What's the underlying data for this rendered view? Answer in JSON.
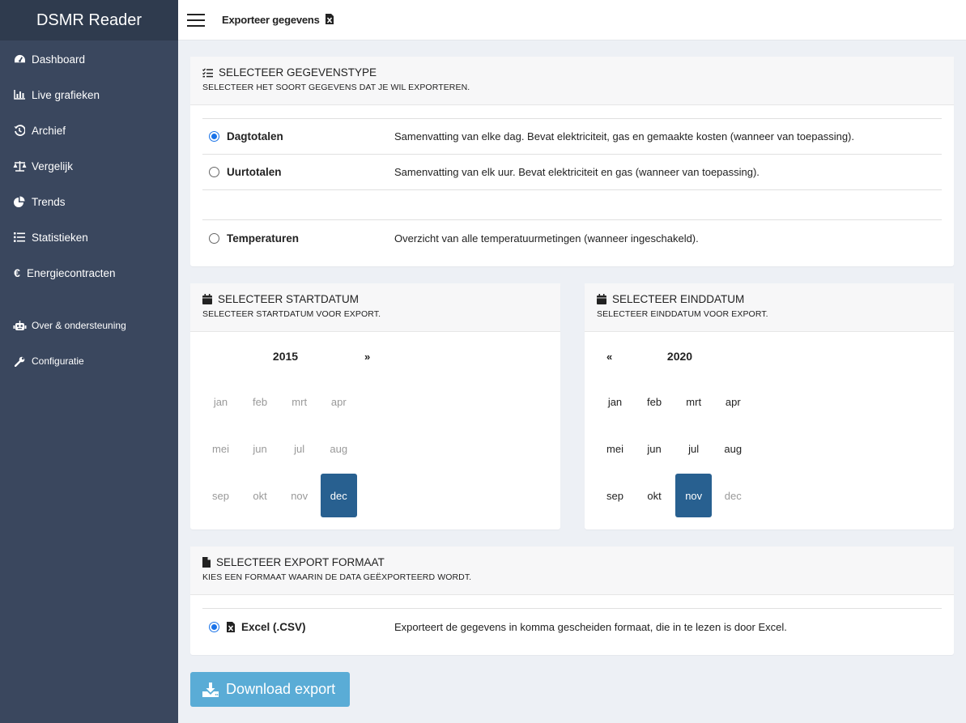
{
  "app": {
    "title": "DSMR Reader"
  },
  "sidebar": {
    "items": [
      {
        "label": "Dashboard",
        "icon": "tachometer-icon"
      },
      {
        "label": "Live grafieken",
        "icon": "bar-chart-icon"
      },
      {
        "label": "Archief",
        "icon": "history-icon"
      },
      {
        "label": "Vergelijk",
        "icon": "balance-scale-icon"
      },
      {
        "label": "Trends",
        "icon": "pie-chart-icon"
      },
      {
        "label": "Statistieken",
        "icon": "list-icon"
      },
      {
        "label": "Energiecontracten",
        "icon": "euro-icon"
      }
    ],
    "secondary": [
      {
        "label": "Over & ondersteuning",
        "icon": "robot-icon"
      },
      {
        "label": "Configuratie",
        "icon": "wrench-icon"
      }
    ]
  },
  "header": {
    "title": "Exporteer gegevens"
  },
  "datatype": {
    "title": "SELECTEER GEGEVENSTYPE",
    "subtitle": "SELECTEER HET SOORT GEGEVENS DAT JE WIL EXPORTEREN.",
    "options": [
      {
        "label": "Dagtotalen",
        "description": "Samenvatting van elke dag. Bevat elektriciteit, gas en gemaakte kosten (wanneer van toepassing).",
        "selected": true
      },
      {
        "label": "Uurtotalen",
        "description": "Samenvatting van elk uur. Bevat elektriciteit en gas (wanneer van toepassing).",
        "selected": false
      },
      {
        "label": "Temperaturen",
        "description": "Overzicht van alle temperatuurmetingen (wanneer ingeschakeld).",
        "selected": false
      }
    ]
  },
  "start": {
    "title": "SELECTEER STARTDATUM",
    "subtitle": "SELECTEER STARTDATUM VOOR EXPORT.",
    "year": "2015",
    "next": "»",
    "months": [
      "jan",
      "feb",
      "mrt",
      "apr",
      "mei",
      "jun",
      "jul",
      "aug",
      "sep",
      "okt",
      "nov",
      "dec"
    ],
    "selected_month": "dec"
  },
  "end": {
    "title": "SELECTEER EINDDATUM",
    "subtitle": "SELECTEER EINDDATUM VOOR EXPORT.",
    "year": "2020",
    "prev": "«",
    "months": [
      "jan",
      "feb",
      "mrt",
      "apr",
      "mei",
      "jun",
      "jul",
      "aug",
      "sep",
      "okt",
      "nov",
      "dec"
    ],
    "selected_month": "nov"
  },
  "format": {
    "title": "SELECTEER EXPORT FORMAAT",
    "subtitle": "KIES EEN FORMAAT WAARIN DE DATA GEËXPORTEERD WORDT.",
    "options": [
      {
        "label": "Excel (.CSV)",
        "description": "Exporteert de gegevens in komma gescheiden formaat, die in te lezen is door Excel.",
        "selected": true
      }
    ]
  },
  "download": {
    "label": "Download export"
  },
  "colors": {
    "sidebar": "#3a475e",
    "brand": "#2f3b4e",
    "accent": "#286090",
    "button": "#5aacd6",
    "radio": "#1a73e8"
  }
}
